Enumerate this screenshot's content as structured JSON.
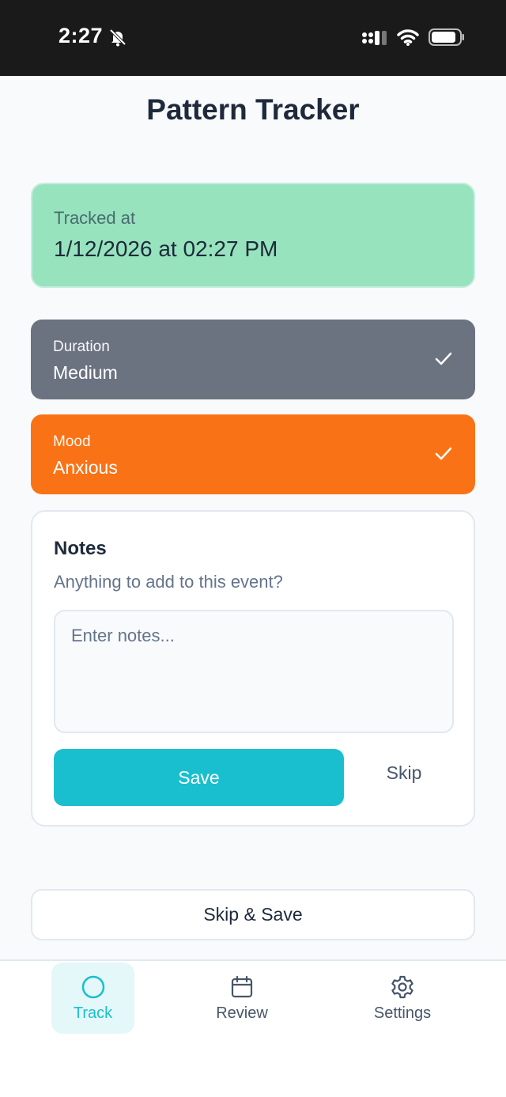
{
  "status_bar": {
    "time": "2:27"
  },
  "header": {
    "title": "Pattern Tracker"
  },
  "tracked": {
    "label": "Tracked at",
    "value": "1/12/2026 at 02:27 PM"
  },
  "duration": {
    "label": "Duration",
    "value": "Medium",
    "color": "#6b7280"
  },
  "mood": {
    "label": "Mood",
    "value": "Anxious",
    "color": "#f97316"
  },
  "notes": {
    "title": "Notes",
    "subtitle": "Anything to add to this event?",
    "placeholder": "Enter notes...",
    "value": "",
    "save_label": "Save",
    "skip_label": "Skip"
  },
  "skip_save_label": "Skip & Save",
  "tabs": [
    {
      "label": "Track",
      "icon": "circle-icon",
      "active": true
    },
    {
      "label": "Review",
      "icon": "calendar-icon",
      "active": false
    },
    {
      "label": "Settings",
      "icon": "gear-icon",
      "active": false
    }
  ],
  "colors": {
    "accent": "#1abfcf",
    "tracked_bg": "#96e3bd"
  }
}
